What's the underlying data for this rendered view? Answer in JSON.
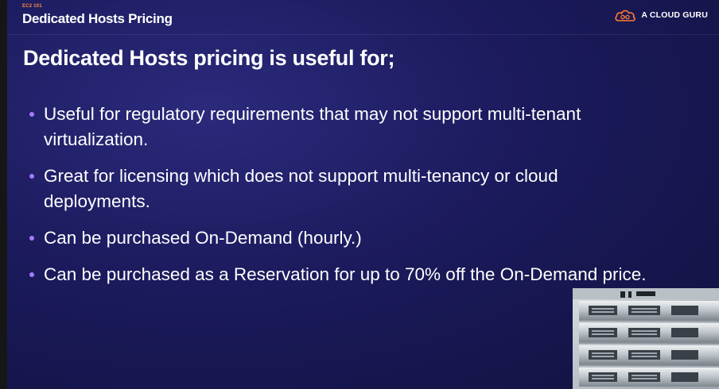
{
  "header": {
    "eyebrow": "EC2 101",
    "title": "Dedicated Hosts Pricing",
    "brand_icon": "cloud-logo-icon",
    "brand_label": "A CLOUD GURU"
  },
  "main": {
    "heading": "Dedicated Hosts pricing is useful for;",
    "bullets": [
      "Useful for regulatory requirements that may not support multi-tenant virtualization.",
      "Great for licensing which does not support multi-tenancy or cloud deployments.",
      "Can be purchased On-Demand (hourly.)",
      "Can be purchased as a Reservation for up to 70% off the On-Demand price."
    ]
  },
  "colors": {
    "background": "#1b1a5c",
    "eyebrow": "#ff8a3d",
    "bullet": "#a57bff",
    "brand_icon": "#ff7a2f"
  }
}
